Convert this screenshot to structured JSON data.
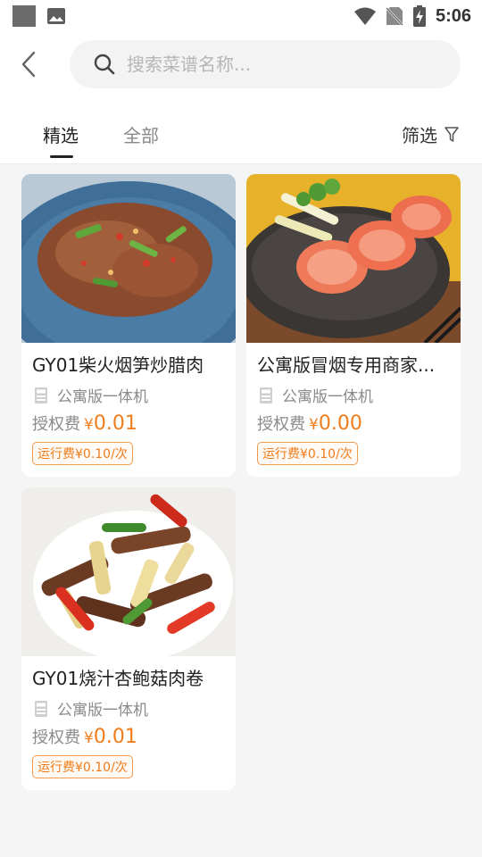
{
  "status_bar": {
    "time": "5:06"
  },
  "search": {
    "placeholder": "搜索菜谱名称..."
  },
  "tabs": [
    {
      "label": "精选",
      "active": true
    },
    {
      "label": "全部",
      "active": false
    }
  ],
  "filter": {
    "label": "筛选"
  },
  "recipes": [
    {
      "title": "GY01柴火烟笋炒腊肉",
      "device": "公寓版一体机",
      "fee_label": "授权费",
      "currency": "¥",
      "price": "0.01",
      "run_fee": "运行费¥0.10/次"
    },
    {
      "title": "公寓版冒烟专用商家...",
      "device": "公寓版一体机",
      "fee_label": "授权费",
      "currency": "¥",
      "price": "0.00",
      "run_fee": "运行费¥0.10/次"
    },
    {
      "title": "GY01烧汁杏鲍菇肉卷",
      "device": "公寓版一体机",
      "fee_label": "授权费",
      "currency": "¥",
      "price": "0.01",
      "run_fee": "运行费¥0.10/次"
    }
  ],
  "colors": {
    "accent": "#f07c1a",
    "background": "#f5f5f5"
  }
}
